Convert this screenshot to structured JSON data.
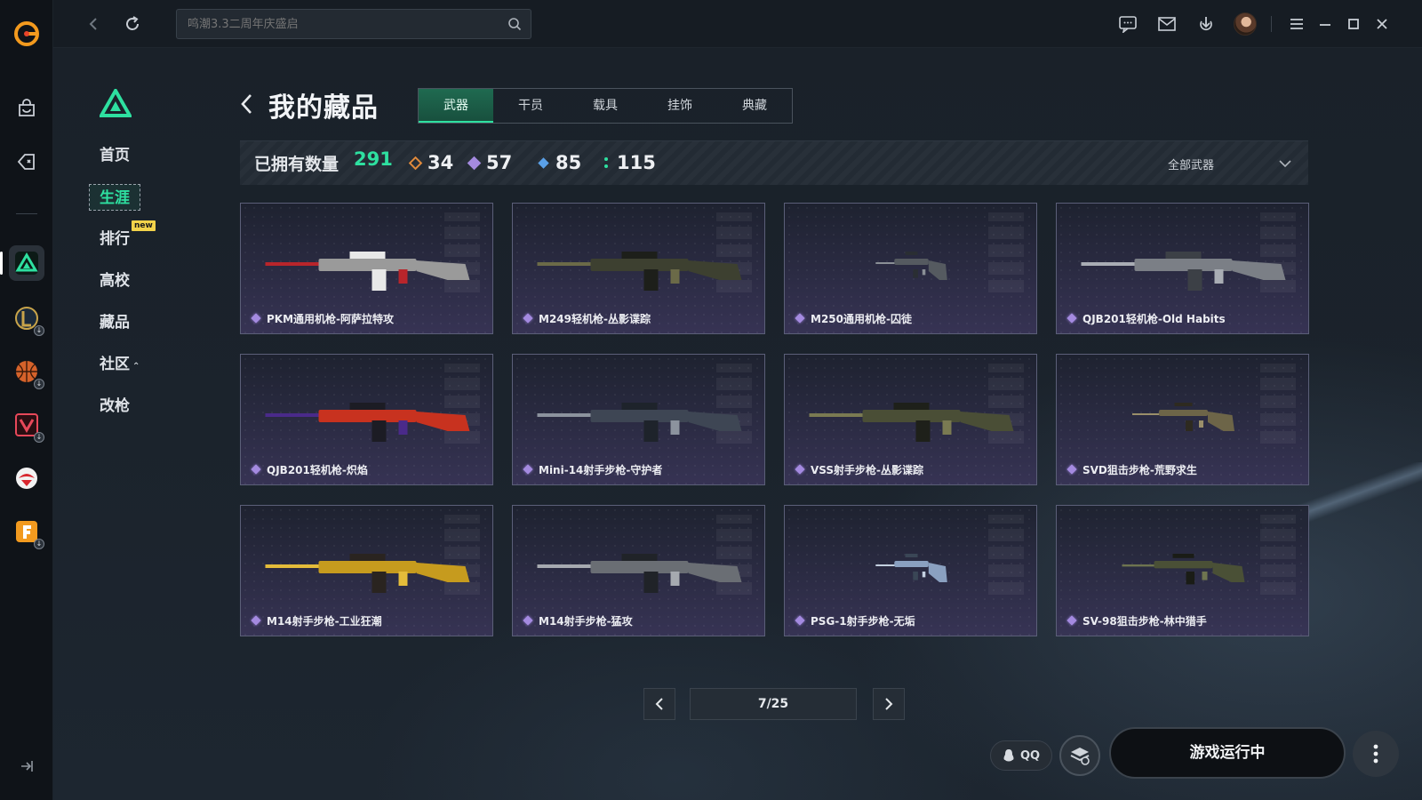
{
  "topbar": {
    "search_placeholder": "鸣潮3.3二周年庆盛启"
  },
  "subnav": {
    "items": [
      {
        "label": "首页"
      },
      {
        "label": "生涯"
      },
      {
        "label": "排行",
        "badge": "new"
      },
      {
        "label": "高校"
      },
      {
        "label": "藏品"
      },
      {
        "label": "社区"
      },
      {
        "label": "改枪"
      }
    ],
    "active_index": 1
  },
  "header": {
    "title": "我的藏品",
    "tabs": [
      {
        "label": "武器"
      },
      {
        "label": "干员"
      },
      {
        "label": "载具"
      },
      {
        "label": "挂饰"
      },
      {
        "label": "典藏"
      }
    ],
    "active_tab": 0
  },
  "stats": {
    "owned_label": "已拥有数量",
    "owned_count": "291",
    "rarities": [
      {
        "value": "34",
        "color": "#e08a3c"
      },
      {
        "value": "57",
        "color": "#a48ae0"
      },
      {
        "value": "85",
        "color": "#5aa0e8"
      },
      {
        "value": "115",
        "color": "#2ee0a0"
      }
    ],
    "filter_label": "全部武器"
  },
  "items": [
    {
      "name": "PKM通用机枪-阿萨拉特攻",
      "palette": [
        "#9a9a9a",
        "#b8252b",
        "#e8e8e8"
      ]
    },
    {
      "name": "M249轻机枪-丛影谍踪",
      "palette": [
        "#3d4030",
        "#6b6a48",
        "#1d1f1a"
      ]
    },
    {
      "name": "M250通用机枪-囚徒",
      "palette": [
        "#555a60",
        "#8a8f96",
        "#2a2e33"
      ]
    },
    {
      "name": "QJB201轻机枪-Old Habits",
      "palette": [
        "#7b7f86",
        "#a9adb4",
        "#3c4046"
      ]
    },
    {
      "name": "QJB201轻机枪-炽焰",
      "palette": [
        "#c8321f",
        "#4a2a8a",
        "#1c1c24"
      ]
    },
    {
      "name": "Mini-14射手步枪-守护者",
      "palette": [
        "#3e4654",
        "#8c939e",
        "#1e232b"
      ]
    },
    {
      "name": "VSS射手步枪-丛影谍踪",
      "palette": [
        "#4a4e36",
        "#7a7a52",
        "#1e201a"
      ]
    },
    {
      "name": "SVD狙击步枪-荒野求生",
      "palette": [
        "#6d6548",
        "#9a8f6a",
        "#2e2a20"
      ]
    },
    {
      "name": "M14射手步枪-工业狂潮",
      "palette": [
        "#c69b1e",
        "#e4bc3a",
        "#2a2420"
      ]
    },
    {
      "name": "M14射手步枪-猛攻",
      "palette": [
        "#6a6e74",
        "#a6aab0",
        "#202328"
      ]
    },
    {
      "name": "PSG-1射手步枪-无垢",
      "palette": [
        "#8aa0c0",
        "#c4d0e0",
        "#3a4656"
      ]
    },
    {
      "name": "SV-98狙击步枪-林中猎手",
      "palette": [
        "#4a5036",
        "#6e7450",
        "#1a1c16"
      ]
    }
  ],
  "pager": {
    "display": "7/25"
  },
  "bottom": {
    "qq_label": "QQ",
    "run_label": "游戏运行中"
  },
  "colors": {
    "accent": "#2ee0a0",
    "card_border": "#5b5f78",
    "rarity_purple": "#a48ae0"
  }
}
